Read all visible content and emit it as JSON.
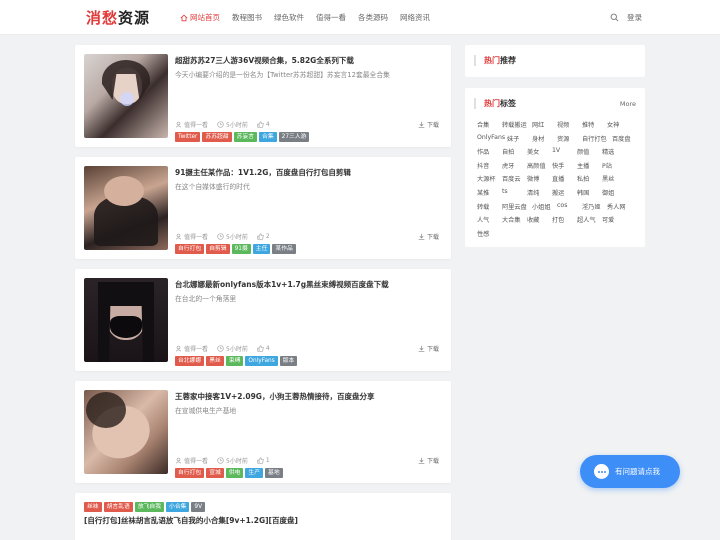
{
  "site": {
    "logo_a": "消愁",
    "logo_b": "资源"
  },
  "nav": [
    {
      "label": "网站首页",
      "active": true
    },
    {
      "label": "教程图书"
    },
    {
      "label": "绿色软件"
    },
    {
      "label": "值得一看"
    },
    {
      "label": "各类源码"
    },
    {
      "label": "网络资讯"
    }
  ],
  "header": {
    "login": "登录"
  },
  "posts": [
    {
      "title": "超甜苏苏27三人游36V视频合集，5.82G全系列下载",
      "desc": "今天小编要介绍的是一份名为【Twitter苏苏超甜】苏妄言12套最全合集",
      "category": "值得一看",
      "time": "5小时前",
      "likes": "4",
      "download": "下载",
      "tags": [
        "Twitter",
        "苏苏超甜",
        "苏妄言",
        "合集",
        "27三人游"
      ]
    },
    {
      "title": "91摄主任某作品：1V1.2G，百度盘自行打包自剪辑",
      "desc": "在这个自媒体盛行的时代",
      "category": "值得一看",
      "time": "5小时前",
      "likes": "2",
      "download": "下载",
      "tags": [
        "自行打包",
        "自剪辑",
        "91摄",
        "主任",
        "某作品"
      ]
    },
    {
      "title": "台北娜娜最新onlyfans版本1v+1.7g黑丝束缚视频百度盘下载",
      "desc": "在台北的一个角落里",
      "category": "值得一看",
      "time": "5小时前",
      "likes": "4",
      "download": "下载",
      "tags": [
        "台北娜娜",
        "黑丝",
        "束缚",
        "OnlyFans",
        "版本"
      ]
    },
    {
      "title": "王蓉家中接客1V+2.09G，小狗王蓉热情接待，百度盘分享",
      "desc": "在宣城供电生产基地",
      "category": "值得一看",
      "time": "5小时前",
      "likes": "1",
      "download": "下载",
      "tags": [
        "自行打包",
        "宣城",
        "供电",
        "生产",
        "基地"
      ]
    }
  ],
  "post5": {
    "tags": [
      "丝袜",
      "胡言乱语",
      "放飞自我",
      "小合集",
      "9V"
    ],
    "title": "[自行打包]丝袜胡言乱语放飞自我的小合集[9v+1.2G][百度盘]"
  },
  "sidebar": {
    "hot_rec": {
      "red": "热门",
      "rest": "推荐"
    },
    "hot_tags": {
      "red": "热门",
      "rest": "标签",
      "more": "More"
    },
    "tags": [
      "合集",
      "转载搬运",
      "网红",
      "视频",
      "推特",
      "女神",
      "OnlyFans",
      "妹子",
      "身材",
      "资源",
      "自行打包",
      "百度盘",
      "作品",
      "自拍",
      "美女",
      "1V",
      "颜值",
      "精选",
      "抖音",
      "虎牙",
      "高颜值",
      "快手",
      "主播",
      "P站",
      "大源杯",
      "百度云",
      "微博",
      "直播",
      "私拍",
      "黑丝",
      "某推",
      "ts",
      "清纯",
      "搬运",
      "韩国",
      "御姐",
      "转载",
      "阿里云盘",
      "小姐姐",
      "cos",
      "淫乃姬",
      "秀人网",
      "人气",
      "大合集",
      "收藏",
      "打包",
      "超人气",
      "可爱",
      "性感"
    ]
  },
  "chat": {
    "label": "有问题请点我"
  },
  "colors": {
    "accent": "#e03a3a",
    "chat": "#3e8ef7"
  }
}
